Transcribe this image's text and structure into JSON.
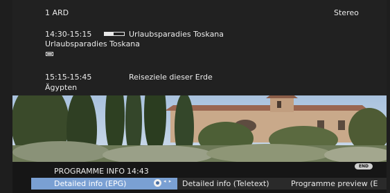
{
  "info": {
    "channel": "1  ARD",
    "audio": "Stereo",
    "now_time": "14:30-15:15",
    "now_progress": 0.45,
    "now_title": "Urlaubsparadies Toskana",
    "now_subtitle": "Urlaubsparadies Toskana",
    "next_time": "15:15-15:45",
    "next_title": "Reiseziele dieser Erde",
    "next_subtitle": "Ägypten"
  },
  "menu": {
    "title": "PROGRAMME INFO",
    "clock": "14:43",
    "end_badge": "END",
    "arrows": "◂ ▸",
    "items": [
      "Detailed info (EPG)",
      "Detailed info (Teletext)",
      "Programme preview (E"
    ]
  },
  "colors": {
    "selected": "#7aa0d3",
    "osd_background": "#212121"
  }
}
